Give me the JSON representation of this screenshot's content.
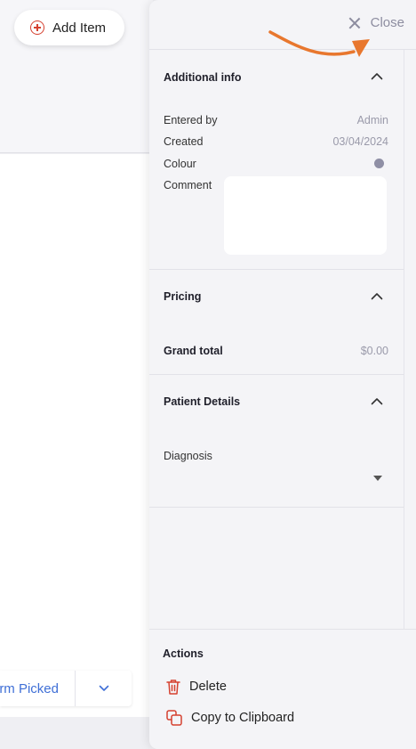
{
  "background": {
    "add_item_label": "Add Item",
    "split_button_label": "rm Picked"
  },
  "drawer": {
    "close_label": "Close",
    "additional_info": {
      "title": "Additional info",
      "entered_by_label": "Entered by",
      "entered_by_value": "Admin",
      "created_label": "Created",
      "created_value": "03/04/2024",
      "colour_label": "Colour",
      "colour_value": "#8f8fa5",
      "comment_label": "Comment",
      "comment_value": ""
    },
    "pricing": {
      "title": "Pricing",
      "grand_total_label": "Grand total",
      "grand_total_value": "$0.00"
    },
    "patient_details": {
      "title": "Patient Details",
      "diagnosis_label": "Diagnosis",
      "diagnosis_value": ""
    },
    "actions": {
      "title": "Actions",
      "delete_label": "Delete",
      "copy_label": "Copy to Clipboard"
    }
  },
  "colors": {
    "accent_red": "#d5402f",
    "link_blue": "#3f6fd6",
    "annotation_orange": "#e8772e"
  }
}
